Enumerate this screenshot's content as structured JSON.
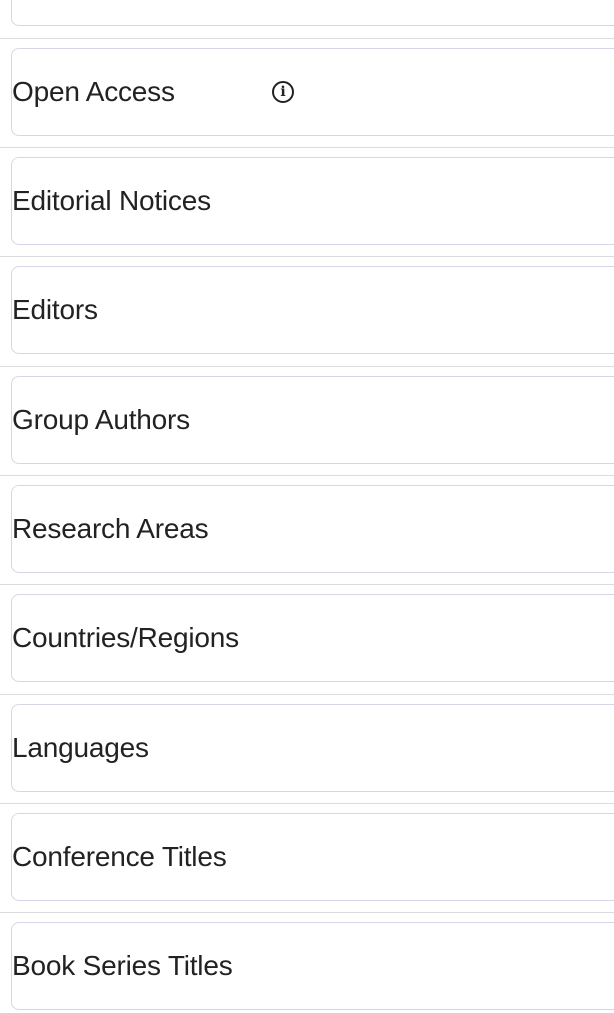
{
  "filters": {
    "items": [
      {
        "label": "Open Access",
        "has_info_icon": true,
        "info_icon": "info-circle-icon"
      },
      {
        "label": "Editorial Notices"
      },
      {
        "label": "Editors"
      },
      {
        "label": "Group Authors"
      },
      {
        "label": "Research Areas"
      },
      {
        "label": "Countries/Regions"
      },
      {
        "label": "Languages"
      },
      {
        "label": "Conference Titles"
      },
      {
        "label": "Book Series Titles"
      }
    ]
  },
  "colors": {
    "panel_border": "#d6d6e8",
    "divider": "#dcdcdc",
    "text": "#222222"
  }
}
